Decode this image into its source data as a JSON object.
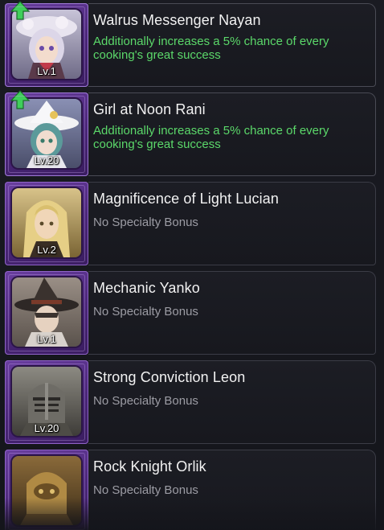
{
  "cooks": [
    {
      "name": "Walrus Messenger Nayan",
      "level": "Lv.1",
      "bonus": "Additionally increases a 5% chance of every cooking's great success",
      "has_bonus": true,
      "upgrade_icon": "green-up-arrow-icon",
      "portrait_icon": "white-haired-girl-with-floral-hat-portrait"
    },
    {
      "name": "Girl at Noon Rani",
      "level": "Lv.20",
      "bonus": "Additionally increases a 5% chance of every cooking's great success",
      "has_bonus": true,
      "upgrade_icon": "green-up-arrow-icon",
      "portrait_icon": "girl-with-white-witch-hat-portrait"
    },
    {
      "name": "Magnificence of Light Lucian",
      "level": "Lv.2",
      "bonus": "No Specialty Bonus",
      "has_bonus": false,
      "portrait_icon": "blonde-long-haired-man-portrait"
    },
    {
      "name": "Mechanic Yanko",
      "level": "Lv.1",
      "bonus": "No Specialty Bonus",
      "has_bonus": false,
      "portrait_icon": "man-with-dark-witch-hat-portrait"
    },
    {
      "name": "Strong Conviction Leon",
      "level": "Lv.20",
      "bonus": "No Specialty Bonus",
      "has_bonus": false,
      "portrait_icon": "armored-knight-helmet-portrait"
    },
    {
      "name": "Rock Knight Orlik",
      "level": "",
      "bonus": "No Specialty Bonus",
      "has_bonus": false,
      "portrait_icon": "golden-armored-knight-portrait"
    }
  ],
  "colors": {
    "frame_purple": "#5a2f8e",
    "bonus_green": "#5bd86a",
    "no_bonus_grey": "#9c9ca4",
    "name_white": "#f2f2f2",
    "panel_border": "#3b3c46"
  }
}
